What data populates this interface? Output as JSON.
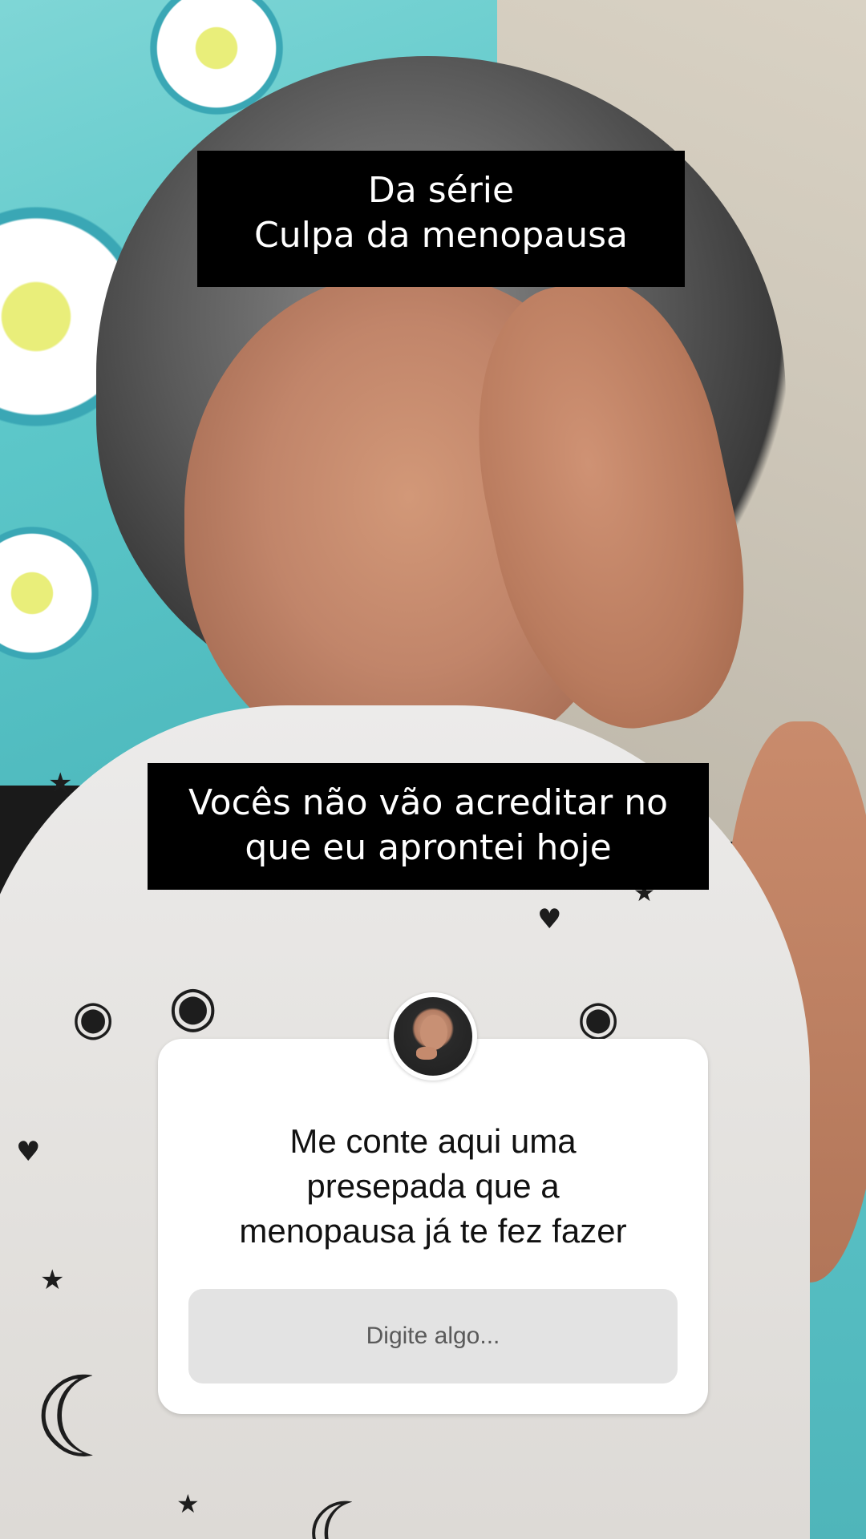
{
  "captions": {
    "top": {
      "line1": "Da série",
      "line2": "Culpa da menopausa"
    },
    "middle": {
      "line1": "Vocês não vão acreditar no",
      "line2": "que eu aprontei hoje"
    }
  },
  "question_sticker": {
    "avatar_icon": "profile-avatar",
    "question_lines": [
      "Me conte aqui uma",
      "presepada que a",
      "menopausa já te fez fazer"
    ],
    "input_placeholder": "Digite algo..."
  },
  "colors": {
    "caption_bg": "#000000",
    "caption_text": "#ffffff",
    "card_bg": "#ffffff",
    "input_bg": "#e3e3e3"
  }
}
